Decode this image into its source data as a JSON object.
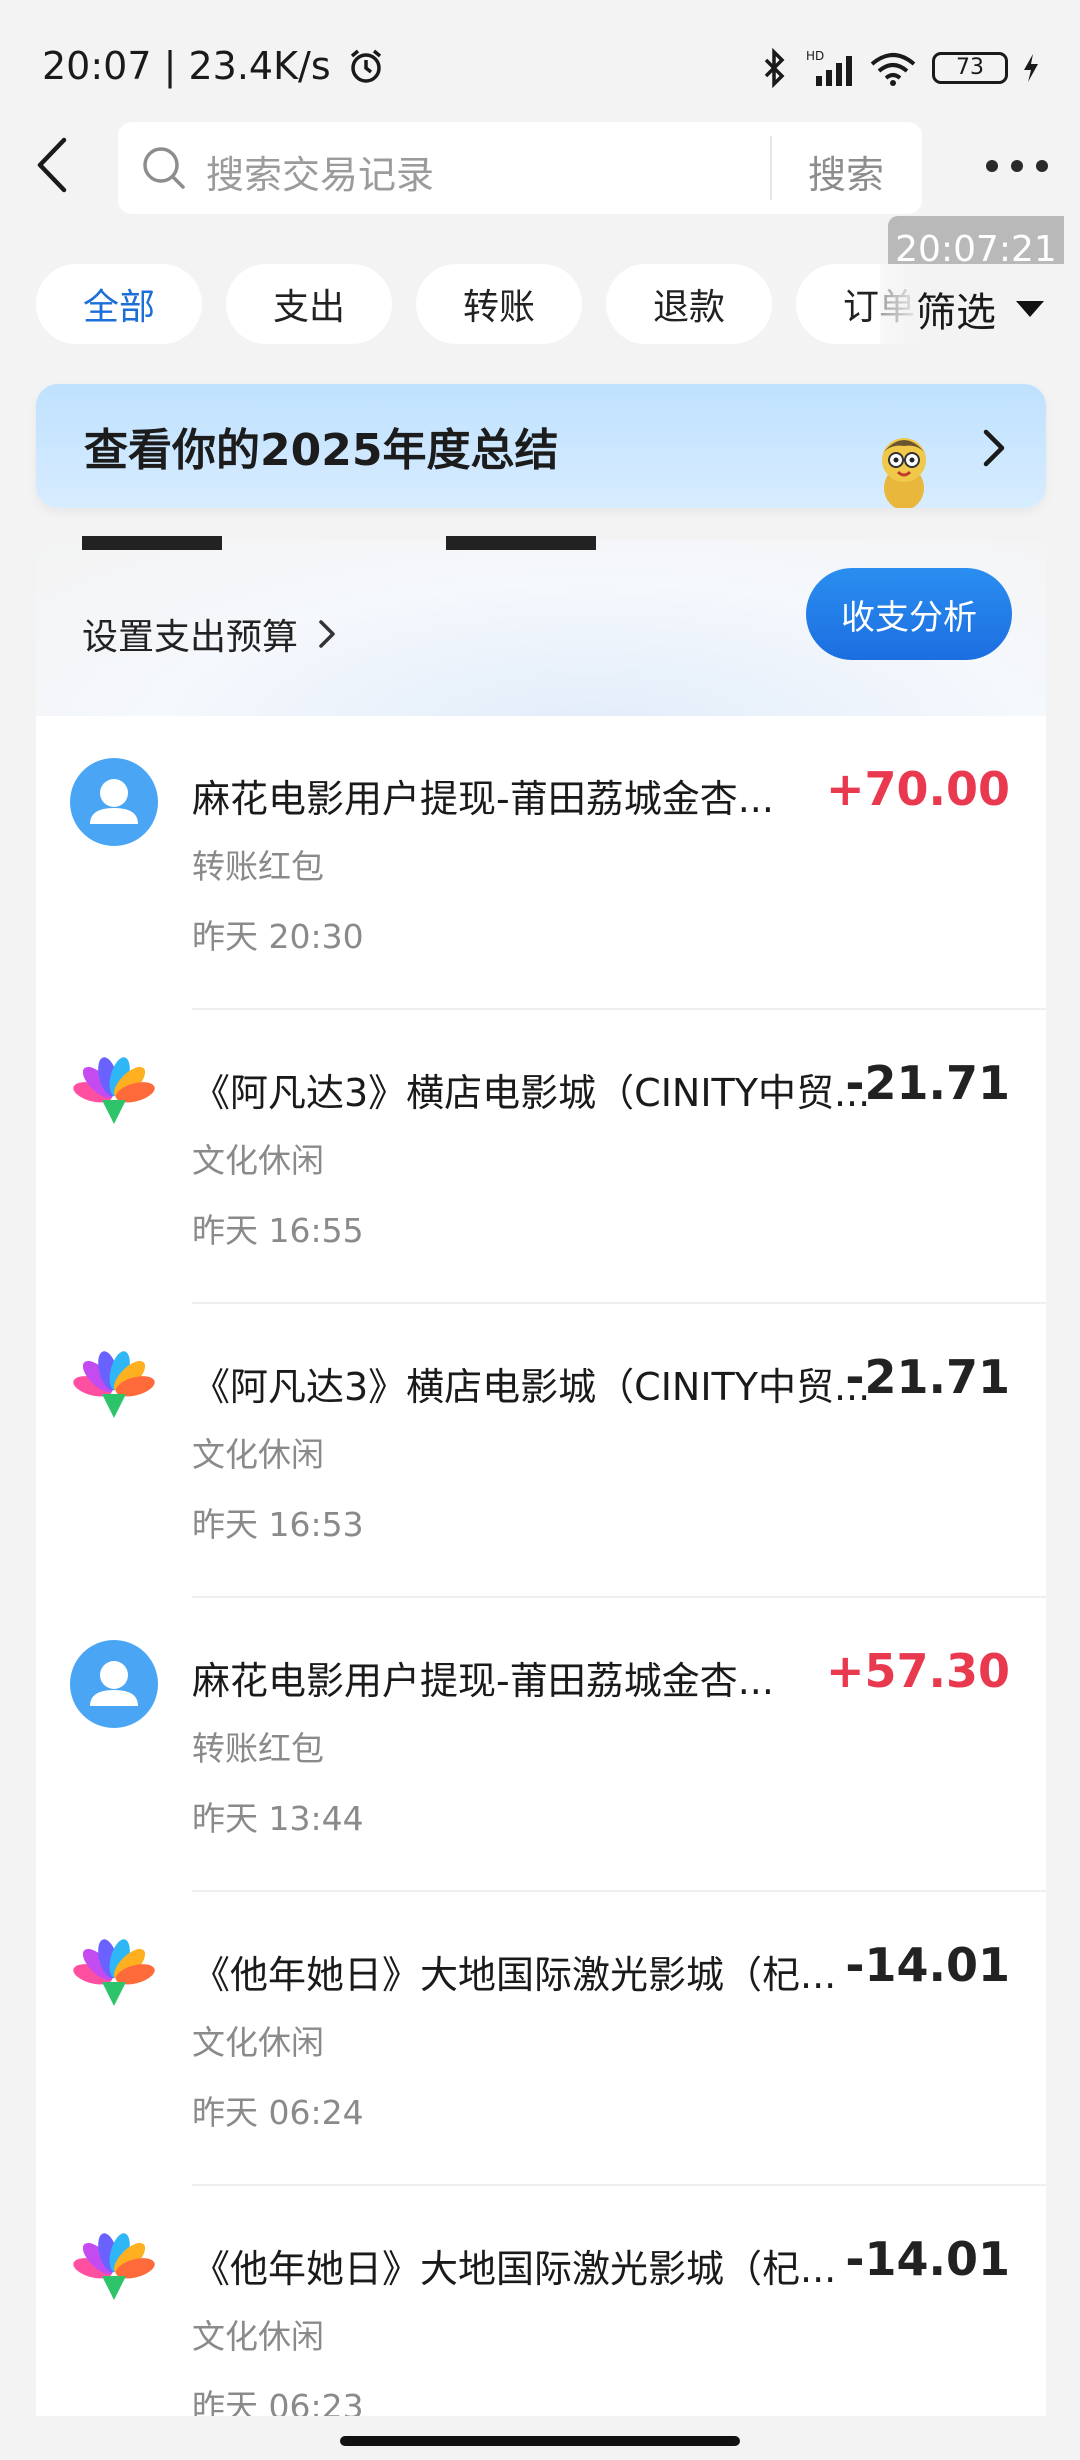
{
  "status": {
    "time": "20:07",
    "speed": "23.4K/s",
    "battery": "73"
  },
  "header": {
    "search_placeholder": "搜索交易记录",
    "search_button": "搜索",
    "timestamp_badge": "20:07:21"
  },
  "filters": {
    "chips": [
      "全部",
      "支出",
      "转账",
      "退款",
      "订单"
    ],
    "filter_label": "筛选"
  },
  "banner": {
    "title": "查看你的2025年度总结"
  },
  "summary": {
    "budget_label": "设置支出预算",
    "analysis_button": "收支分析"
  },
  "transactions": [
    {
      "name": "麻花电影用户提现-莆田荔城金杏...",
      "category": "转账红包",
      "time": "昨天 20:30",
      "amount": "+70.00",
      "direction": "in",
      "icon": "user-avatar-icon"
    },
    {
      "name": "《阿凡达3》横店电影城（CINITY中贸...",
      "category": "文化休闲",
      "time": "昨天 16:55",
      "amount": "-21.71",
      "direction": "out",
      "icon": "culture-leisure-icon"
    },
    {
      "name": "《阿凡达3》横店电影城（CINITY中贸...",
      "category": "文化休闲",
      "time": "昨天 16:53",
      "amount": "-21.71",
      "direction": "out",
      "icon": "culture-leisure-icon"
    },
    {
      "name": "麻花电影用户提现-莆田荔城金杏...",
      "category": "转账红包",
      "time": "昨天 13:44",
      "amount": "+57.30",
      "direction": "in",
      "icon": "user-avatar-icon"
    },
    {
      "name": "《他年她日》大地国际激光影城（杞...",
      "category": "文化休闲",
      "time": "昨天 06:24",
      "amount": "-14.01",
      "direction": "out",
      "icon": "culture-leisure-icon"
    },
    {
      "name": "《他年她日》大地国际激光影城（杞...",
      "category": "文化休闲",
      "time": "昨天 06:23",
      "amount": "-14.01",
      "direction": "out",
      "icon": "culture-leisure-icon"
    }
  ],
  "colors": {
    "accent": "#1c6ed8",
    "income": "#e8394f",
    "expense": "#222222"
  }
}
